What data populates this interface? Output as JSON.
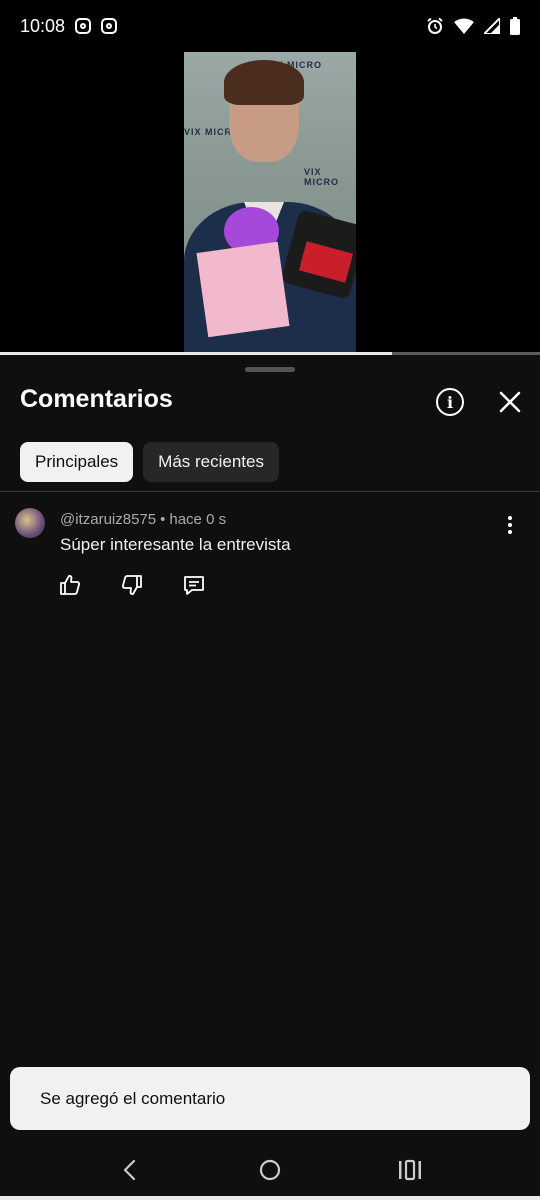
{
  "status_bar": {
    "time": "10:08",
    "left_icons": [
      "instagram-icon",
      "instagram-icon"
    ],
    "right_icons": [
      "alarm-icon",
      "wifi-icon",
      "signal-icon",
      "battery-icon"
    ]
  },
  "video": {
    "progress_fraction": 0.725
  },
  "comments_panel": {
    "title": "Comentarios",
    "info_icon": "info-icon",
    "close_icon": "close-icon",
    "tabs": [
      {
        "label": "Principales",
        "selected": true
      },
      {
        "label": "Más recientes",
        "selected": false
      }
    ],
    "comments": [
      {
        "author": "@itzaruiz8575",
        "separator": "•",
        "time": "hace 0 s",
        "text": "Súper interesante la entrevista",
        "actions": [
          "like-icon",
          "dislike-icon",
          "reply-icon"
        ]
      }
    ]
  },
  "toast": {
    "message": "Se agregó el comentario"
  },
  "nav_bar": {
    "buttons": [
      "back-icon",
      "home-icon",
      "recents-icon"
    ]
  },
  "colors": {
    "background": "#0f0f0f",
    "chip_active": "#f1f1f1",
    "chip_inactive": "#272727",
    "toast_bg": "#f1f1f1"
  }
}
